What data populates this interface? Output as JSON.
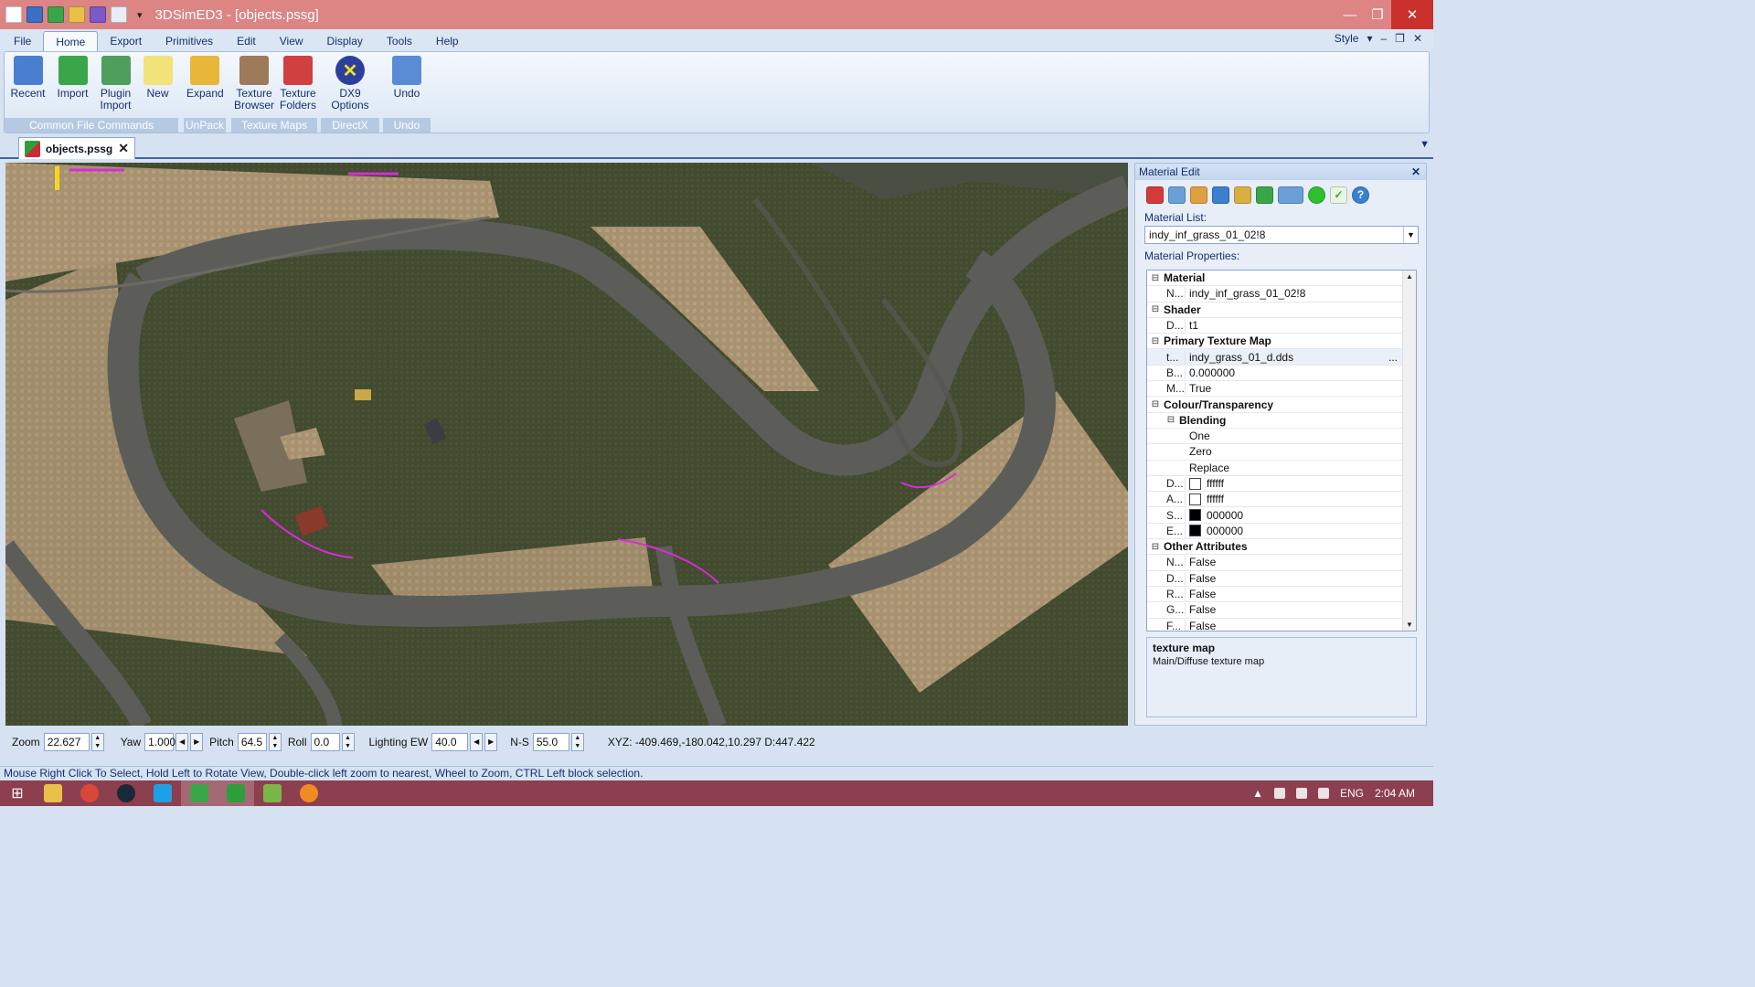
{
  "window": {
    "title": "3DSimED3 - [objects.pssg]"
  },
  "quick_access": {
    "icons": [
      "new-file-icon",
      "save-icon",
      "import-icon",
      "open-folder-icon",
      "plugin-icon",
      "copy-icon"
    ],
    "dropdown": "▾"
  },
  "menu": {
    "tabs": [
      "File",
      "Home",
      "Export",
      "Primitives",
      "Edit",
      "View",
      "Display",
      "Tools",
      "Help"
    ],
    "active": "Home",
    "style_label": "Style"
  },
  "ribbon": {
    "groups": [
      {
        "label": "Common File Commands",
        "buttons": [
          {
            "label": "Recent",
            "icon": "recent-icon",
            "color": "#4a7fd0"
          },
          {
            "label": "Import",
            "icon": "import-icon",
            "color": "#3aa64a"
          },
          {
            "label": "Plugin\nImport",
            "icon": "plugin-import-icon",
            "color": "#4f9e5c"
          },
          {
            "label": "New",
            "icon": "new-icon",
            "color": "#f2e27a"
          }
        ]
      },
      {
        "label": "UnPack",
        "buttons": [
          {
            "label": "Expand",
            "icon": "expand-icon",
            "color": "#e8b73a"
          }
        ]
      },
      {
        "label": "Texture Maps",
        "buttons": [
          {
            "label": "Texture\nBrowser",
            "icon": "texture-browser-icon",
            "color": "#9c7a5a"
          },
          {
            "label": "Texture\nFolders",
            "icon": "texture-folders-icon",
            "color": "#d04040"
          }
        ]
      },
      {
        "label": "DirectX",
        "buttons": [
          {
            "label": "DX9\nOptions",
            "icon": "directx-icon",
            "color": "#2b3f9e"
          }
        ]
      },
      {
        "label": "Undo",
        "buttons": [
          {
            "label": "Undo",
            "icon": "undo-icon",
            "color": "#5a8cd6"
          }
        ]
      }
    ]
  },
  "document_tab": {
    "label": "objects.pssg"
  },
  "material_edit": {
    "title": "Material Edit",
    "material_list_label": "Material List:",
    "material_list_value": "indy_inf_grass_01_02!8",
    "material_properties_label": "Material Properties:",
    "properties": [
      {
        "kind": "category",
        "name": "Material"
      },
      {
        "kind": "prop",
        "name": "N...",
        "value": "indy_inf_grass_01_02!8"
      },
      {
        "kind": "category",
        "name": "Shader"
      },
      {
        "kind": "prop",
        "name": "D...",
        "value": "t1"
      },
      {
        "kind": "category",
        "name": "Primary Texture Map"
      },
      {
        "kind": "prop",
        "name": "t...",
        "value": "indy_grass_01_d.dds",
        "selected": true
      },
      {
        "kind": "prop",
        "name": "B...",
        "value": "0.000000"
      },
      {
        "kind": "prop",
        "name": "M...",
        "value": "True"
      },
      {
        "kind": "category",
        "name": "Colour/Transparency"
      },
      {
        "kind": "subcategory",
        "name": "Blending"
      },
      {
        "kind": "sub",
        "name": "",
        "value": "One"
      },
      {
        "kind": "sub",
        "name": "",
        "value": "Zero"
      },
      {
        "kind": "sub",
        "name": "",
        "value": "Replace"
      },
      {
        "kind": "prop",
        "name": "D...",
        "value": "ffffff",
        "swatch": "#ffffff"
      },
      {
        "kind": "prop",
        "name": "A...",
        "value": "ffffff",
        "swatch": "#ffffff"
      },
      {
        "kind": "prop",
        "name": "S...",
        "value": "000000",
        "swatch": "#000000"
      },
      {
        "kind": "prop",
        "name": "E...",
        "value": "000000",
        "swatch": "#000000"
      },
      {
        "kind": "category",
        "name": "Other Attributes"
      },
      {
        "kind": "prop",
        "name": "N...",
        "value": "False"
      },
      {
        "kind": "prop",
        "name": "D...",
        "value": "False"
      },
      {
        "kind": "prop",
        "name": "R...",
        "value": "False"
      },
      {
        "kind": "prop",
        "name": "G...",
        "value": "False"
      },
      {
        "kind": "prop",
        "name": "F...",
        "value": "False"
      }
    ],
    "description_title": "texture map",
    "description_text": "Main/Diffuse texture map"
  },
  "controls": {
    "zoom_label": "Zoom",
    "zoom": "22.627",
    "yaw_label": "Yaw",
    "yaw": "1.000",
    "pitch_label": "Pitch",
    "pitch": "64.5",
    "roll_label": "Roll",
    "roll": "0.0",
    "lighting_ew_label": "Lighting EW",
    "lighting_ew": "40.0",
    "ns_label": "N-S",
    "ns": "55.0",
    "coords": "XYZ: -409.469,-180.042,10.297  D:447.422"
  },
  "status": {
    "hint": "Mouse Right Click To Select, Hold Left to Rotate View, Double-click left  zoom to nearest, Wheel to Zoom, CTRL Left block selection."
  },
  "taskbar": {
    "apps": [
      {
        "icon": "file-explorer-icon",
        "color": "#e8c04a"
      },
      {
        "icon": "chrome-icon",
        "color": "#d9473a"
      },
      {
        "icon": "steam-icon",
        "color": "#1b2838"
      },
      {
        "icon": "skype-icon",
        "color": "#1da1e2"
      },
      {
        "icon": "app-green-icon",
        "color": "#3aa64a"
      },
      {
        "icon": "3dsimed-icon",
        "color": "#2e9e3a"
      },
      {
        "icon": "image-editor-icon",
        "color": "#7ab648"
      },
      {
        "icon": "orange-app-icon",
        "color": "#f08a24"
      }
    ],
    "language": "ENG",
    "time": "2:04 AM"
  }
}
